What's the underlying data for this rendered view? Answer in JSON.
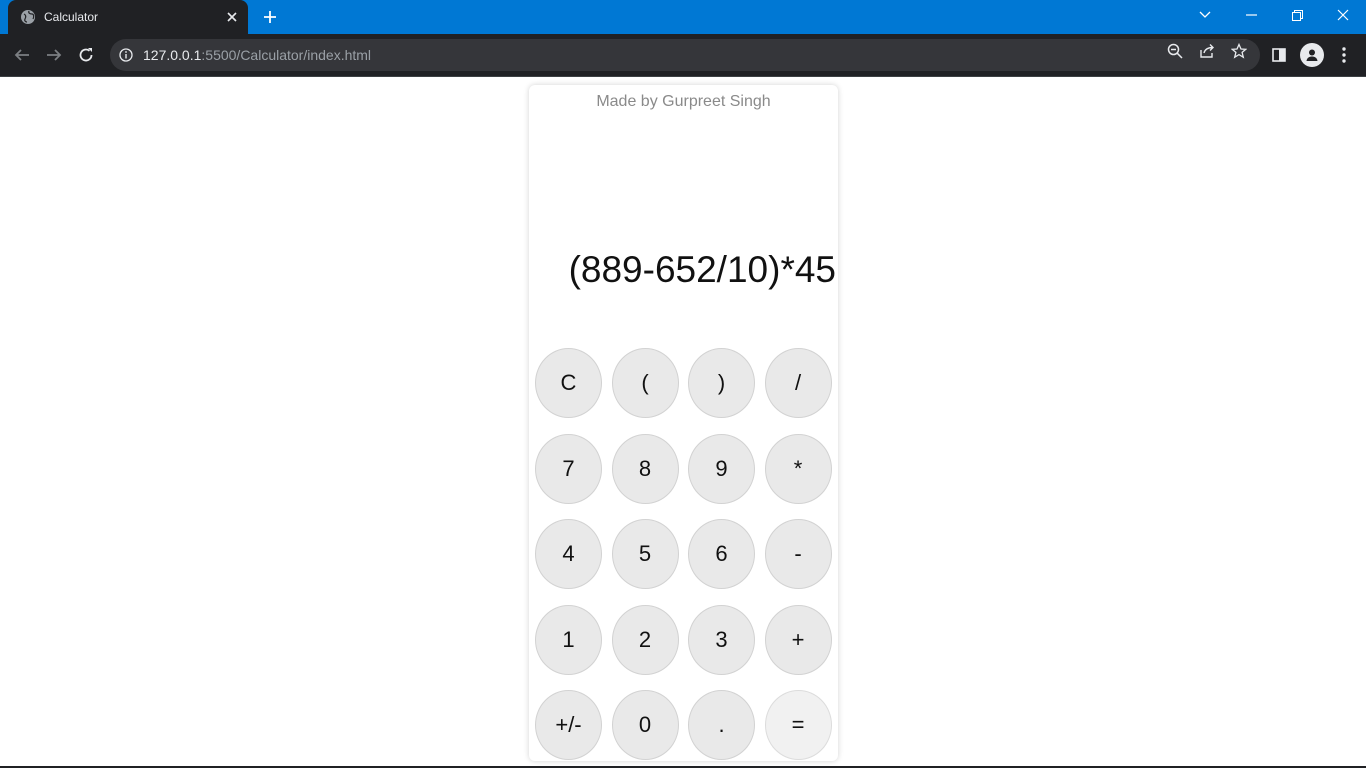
{
  "browser": {
    "tab_title": "Calculator",
    "url_host": "127.0.0.1",
    "url_rest": ":5500/Calculator/index.html",
    "icons": [
      "globe-icon",
      "close-icon",
      "plus-icon",
      "chevron-down-icon",
      "minimize-icon",
      "restore-icon",
      "window-close-icon",
      "back-icon",
      "forward-icon",
      "reload-icon",
      "info-icon",
      "zoom-icon",
      "share-icon",
      "star-icon",
      "sidepanel-icon",
      "profile-icon",
      "menu-icon"
    ]
  },
  "calculator": {
    "credit": "Made by Gurpreet Singh",
    "expression": "(889-652/10)*45",
    "keys": [
      "C",
      "(",
      ")",
      "/",
      "7",
      "8",
      "9",
      "*",
      "4",
      "5",
      "6",
      "-",
      "1",
      "2",
      "3",
      "+",
      "+/-",
      "0",
      ".",
      "="
    ]
  },
  "colors": {
    "titlebar": "#0078d4",
    "toolbar": "#202124",
    "key_bg": "#e9e9e9"
  }
}
